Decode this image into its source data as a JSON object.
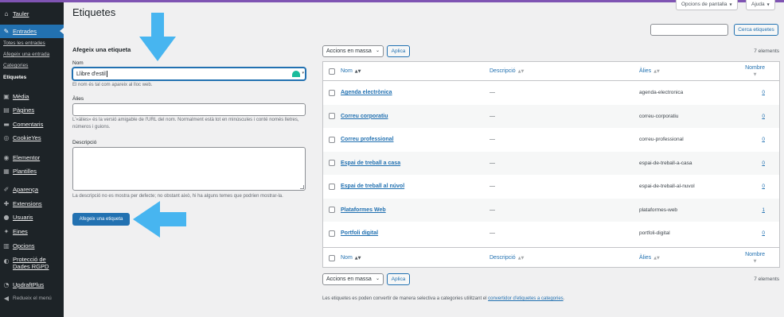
{
  "sidebar": {
    "items": [
      {
        "label": "Tauler",
        "icon": "dashboard-icon",
        "glyph": "⌂"
      },
      {
        "label": "Entrades",
        "icon": "pin-icon",
        "glyph": "✎"
      },
      {
        "label": "Mèdia",
        "icon": "media-icon",
        "glyph": "▣"
      },
      {
        "label": "Pàgines",
        "icon": "pages-icon",
        "glyph": "▤"
      },
      {
        "label": "Comentaris",
        "icon": "comments-icon",
        "glyph": "▬"
      },
      {
        "label": "CookieYes",
        "icon": "cookie-icon",
        "glyph": "◎"
      },
      {
        "label": "Elementor",
        "icon": "elementor-icon",
        "glyph": "◉"
      },
      {
        "label": "Plantilles",
        "icon": "templates-icon",
        "glyph": "▦"
      },
      {
        "label": "Aparença",
        "icon": "appearance-icon",
        "glyph": "✐"
      },
      {
        "label": "Extensions",
        "icon": "plugins-icon",
        "glyph": "✚"
      },
      {
        "label": "Usuaris",
        "icon": "users-icon",
        "glyph": "●"
      },
      {
        "label": "Eines",
        "icon": "tools-icon",
        "glyph": "✦"
      },
      {
        "label": "Opcions",
        "icon": "settings-icon",
        "glyph": "▥"
      },
      {
        "label": "Protecció de Dades RGPD",
        "icon": "eye-icon",
        "glyph": "◐"
      },
      {
        "label": "UpdraftPlus",
        "icon": "updraft-icon",
        "glyph": "◔"
      }
    ],
    "submenu": [
      "Totes les entrades",
      "Afegeix una entrada",
      "Categories",
      "Etiquetes"
    ],
    "collapse": {
      "label": "Redueix el menú",
      "glyph": "◀"
    }
  },
  "topbar": {
    "screen_options": "Opcions de pantalla",
    "help": "Ajuda",
    "caret": "▼"
  },
  "page": {
    "title": "Etiquetes"
  },
  "form": {
    "heading": "Afegeix una etiqueta",
    "name_label": "Nom",
    "name_value": "Llibre d'estil",
    "name_help": "El nom és tal com apareix al lloc web.",
    "slug_label": "Àlies",
    "slug_value": "",
    "slug_help": "L'«àlies» és la versió amigable de l'URL del nom. Normalment està tot en minúscules i conté només lletres, números i guions.",
    "desc_label": "Descripció",
    "desc_value": "",
    "desc_help": "La descripció no es mostra per defecte; no obstant això, hi ha alguns temes que podrien mostrar-la.",
    "submit": "Afegeix una etiqueta"
  },
  "search": {
    "placeholder": "",
    "button": "Cerca etiquetes"
  },
  "bulk": {
    "select": "Accions en massa",
    "apply": "Aplica",
    "count": "7 elements"
  },
  "table": {
    "headers": {
      "name": "Nom",
      "description": "Descripció",
      "slug": "Àlies",
      "count": "Nombre"
    },
    "sort_glyph": "▲▼",
    "rows": [
      {
        "name": "Agenda electrònica",
        "description": "—",
        "slug": "agenda-electronica",
        "count": "0"
      },
      {
        "name": "Correu corporatiu",
        "description": "—",
        "slug": "correu-corporatiu",
        "count": "0"
      },
      {
        "name": "Correu professional",
        "description": "—",
        "slug": "correu-professional",
        "count": "0"
      },
      {
        "name": "Espai de treball a casa",
        "description": "—",
        "slug": "espai-de-treball-a-casa",
        "count": "0"
      },
      {
        "name": "Espai de treball al núvol",
        "description": "—",
        "slug": "espai-de-treball-al-nuvol",
        "count": "0"
      },
      {
        "name": "Plataformes Web",
        "description": "—",
        "slug": "plataformes-web",
        "count": "1"
      },
      {
        "name": "Portfoli digital",
        "description": "—",
        "slug": "portfoli-digital",
        "count": "0"
      }
    ]
  },
  "footer_note": {
    "text": "Les etiquetes es poden convertir de manera selectiva a categories utilitzant el ",
    "link": "convertidor d'etiquetes a categories",
    "end": "."
  },
  "colors": {
    "accent": "#2271b1",
    "arrow": "#47b5f0",
    "sidebar": "#1d2327",
    "admin_bar": "#7f54b3"
  }
}
